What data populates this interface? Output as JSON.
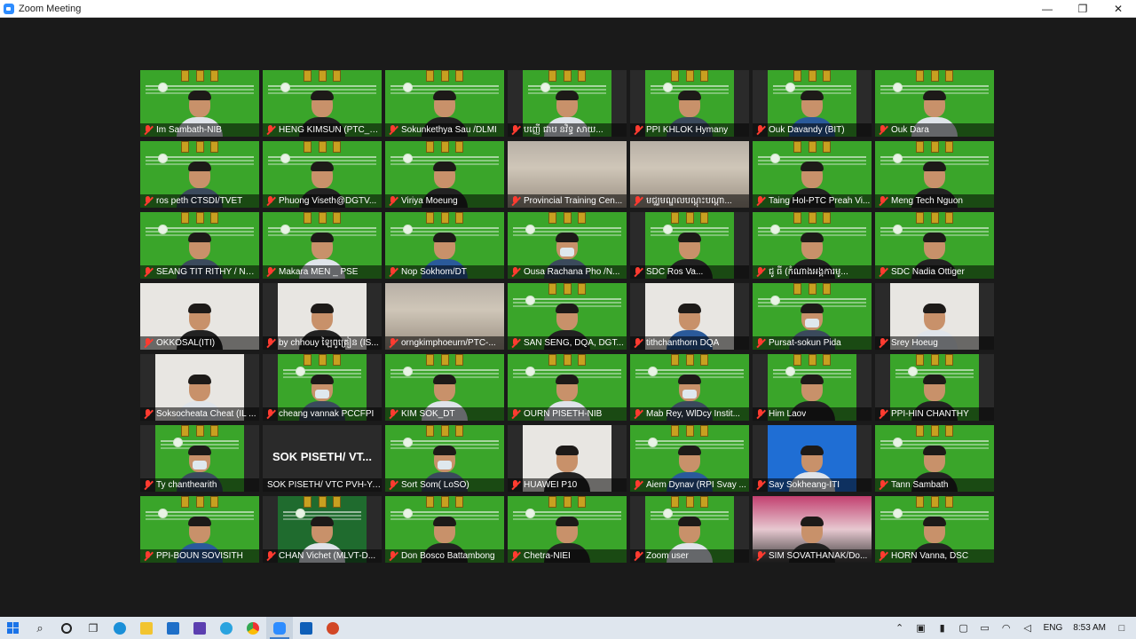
{
  "window": {
    "title": "Zoom Meeting",
    "minimize": "—",
    "maximize": "❐",
    "close": "✕"
  },
  "tiles": [
    {
      "name": "Im Sambath-NIB",
      "style": "full",
      "person": "light"
    },
    {
      "name": "HENG KIMSUN (PTC_O...",
      "style": "full",
      "person": "dark"
    },
    {
      "name": "Sokunkethya Sau /DLMI",
      "style": "full",
      "person": "dark"
    },
    {
      "name": "បញ្ញើ ជាប នវិទ្ធ សាយ...",
      "style": "narrow",
      "person": "light"
    },
    {
      "name": "PPI KHLOK Hymany",
      "style": "narrow",
      "person": ""
    },
    {
      "name": "Ouk Davandy (BIT)",
      "style": "narrow",
      "person": "blue"
    },
    {
      "name": "Ouk Dara",
      "style": "full",
      "person": "light"
    },
    {
      "name": "ros peth CTSDI/TVET",
      "style": "full",
      "person": ""
    },
    {
      "name": "Phuong Viseth@DGTV...",
      "style": "full",
      "person": "dark"
    },
    {
      "name": "Viriya Moeung",
      "style": "full",
      "person": "dark"
    },
    {
      "name": "Provincial Training Cen...",
      "style": "room",
      "person": "none"
    },
    {
      "name": "មជ្ឈមណ្ឌលបណ្ដុះបណ្ដា...",
      "style": "room",
      "person": "none"
    },
    {
      "name": "Taing Hol-PTC Preah Vi...",
      "style": "full",
      "person": "dark"
    },
    {
      "name": "Meng Tech Nguon",
      "style": "full",
      "person": "dark"
    },
    {
      "name": "SEANG TIT RITHY / NPI...",
      "style": "full",
      "person": ""
    },
    {
      "name": "Makara MEN _ PSE",
      "style": "full",
      "person": "light"
    },
    {
      "name": "Nop Sokhom/DT",
      "style": "full",
      "person": "blue"
    },
    {
      "name": "Ousa Rachana Pho /N...",
      "style": "full",
      "person": "mask"
    },
    {
      "name": "SDC Ros Va...",
      "style": "narrow",
      "person": "dark"
    },
    {
      "name": "ជូ ធី (កំណាងអង្គការមូ...",
      "style": "full",
      "person": "dark"
    },
    {
      "name": "SDC Nadia Ottiger",
      "style": "full",
      "person": "dark"
    },
    {
      "name": "OKKOSAL(ITI)",
      "style": "photo",
      "person": "dark"
    },
    {
      "name": "by chhouy ឡៃពូគ្រៀន (IS...",
      "style": "photo-narrow",
      "person": "dark"
    },
    {
      "name": "orngkimphoeurn/PTC-...",
      "style": "room",
      "person": "none"
    },
    {
      "name": "SAN SENG, DQA, DGT...",
      "style": "full",
      "person": "dark"
    },
    {
      "name": "tithchanthorn DQA",
      "style": "photo-narrow",
      "person": "blue"
    },
    {
      "name": "Pursat-sokun Pida",
      "style": "full",
      "person": "mask"
    },
    {
      "name": "Srey Hoeug",
      "style": "photo-narrow",
      "person": "light"
    },
    {
      "name": "Soksocheata Cheat (IL ...",
      "style": "photo-narrow",
      "person": "light"
    },
    {
      "name": "cheang vannak PCCFPI",
      "style": "narrow",
      "person": "mask"
    },
    {
      "name": "KIM SOK_DT",
      "style": "full",
      "person": "light"
    },
    {
      "name": "OURN PISETH-NIB",
      "style": "full",
      "person": "light"
    },
    {
      "name": "Mab Rey, WlDcy Instit...",
      "style": "full",
      "person": "mask"
    },
    {
      "name": "Him Laov",
      "style": "narrow",
      "person": "dark"
    },
    {
      "name": "PPI-HIN CHANTHY",
      "style": "narrow",
      "person": "dark"
    },
    {
      "name": "Ty chanthearith",
      "style": "narrow",
      "person": "mask"
    },
    {
      "name": "SOK PISETH/ VTC PVH-YA...",
      "style": "nameonly",
      "label": "SOK PISETH/ VT..."
    },
    {
      "name": "Sort Som( LoSO)",
      "style": "full",
      "person": "mask"
    },
    {
      "name": "HUAWEI P10",
      "style": "photo-narrow",
      "person": "dark"
    },
    {
      "name": "Aiem Dynav (RPI Svay ...",
      "style": "full",
      "person": "blue"
    },
    {
      "name": "Say Sokheang-ITI",
      "style": "blue-narrow",
      "person": "light"
    },
    {
      "name": "Tann Sambath",
      "style": "full",
      "person": "dark"
    },
    {
      "name": "PPI-BOUN SOVISITH",
      "style": "full",
      "person": "blue"
    },
    {
      "name": "CHAN Vichet (MLVT-D...",
      "style": "darkgreen-narrow",
      "person": "light"
    },
    {
      "name": "Don Bosco Battambong",
      "style": "full",
      "person": "dark"
    },
    {
      "name": "Chetra-NIEI",
      "style": "full",
      "person": "dark"
    },
    {
      "name": "Zoom user",
      "style": "narrow",
      "person": "light"
    },
    {
      "name": "SIM SOVATHANAK/Do...",
      "style": "pink",
      "person": "dark"
    },
    {
      "name": "HORN Vanna, DSC",
      "style": "full",
      "person": "dark"
    }
  ],
  "taskbar": {
    "apps": [
      "start",
      "search",
      "cortana",
      "task-view",
      "edge",
      "explorer",
      "mail",
      "vs",
      "telegram",
      "chrome",
      "zoom",
      "outlook",
      "powerpoint"
    ],
    "language": "ENG",
    "time": "8:53 AM"
  }
}
